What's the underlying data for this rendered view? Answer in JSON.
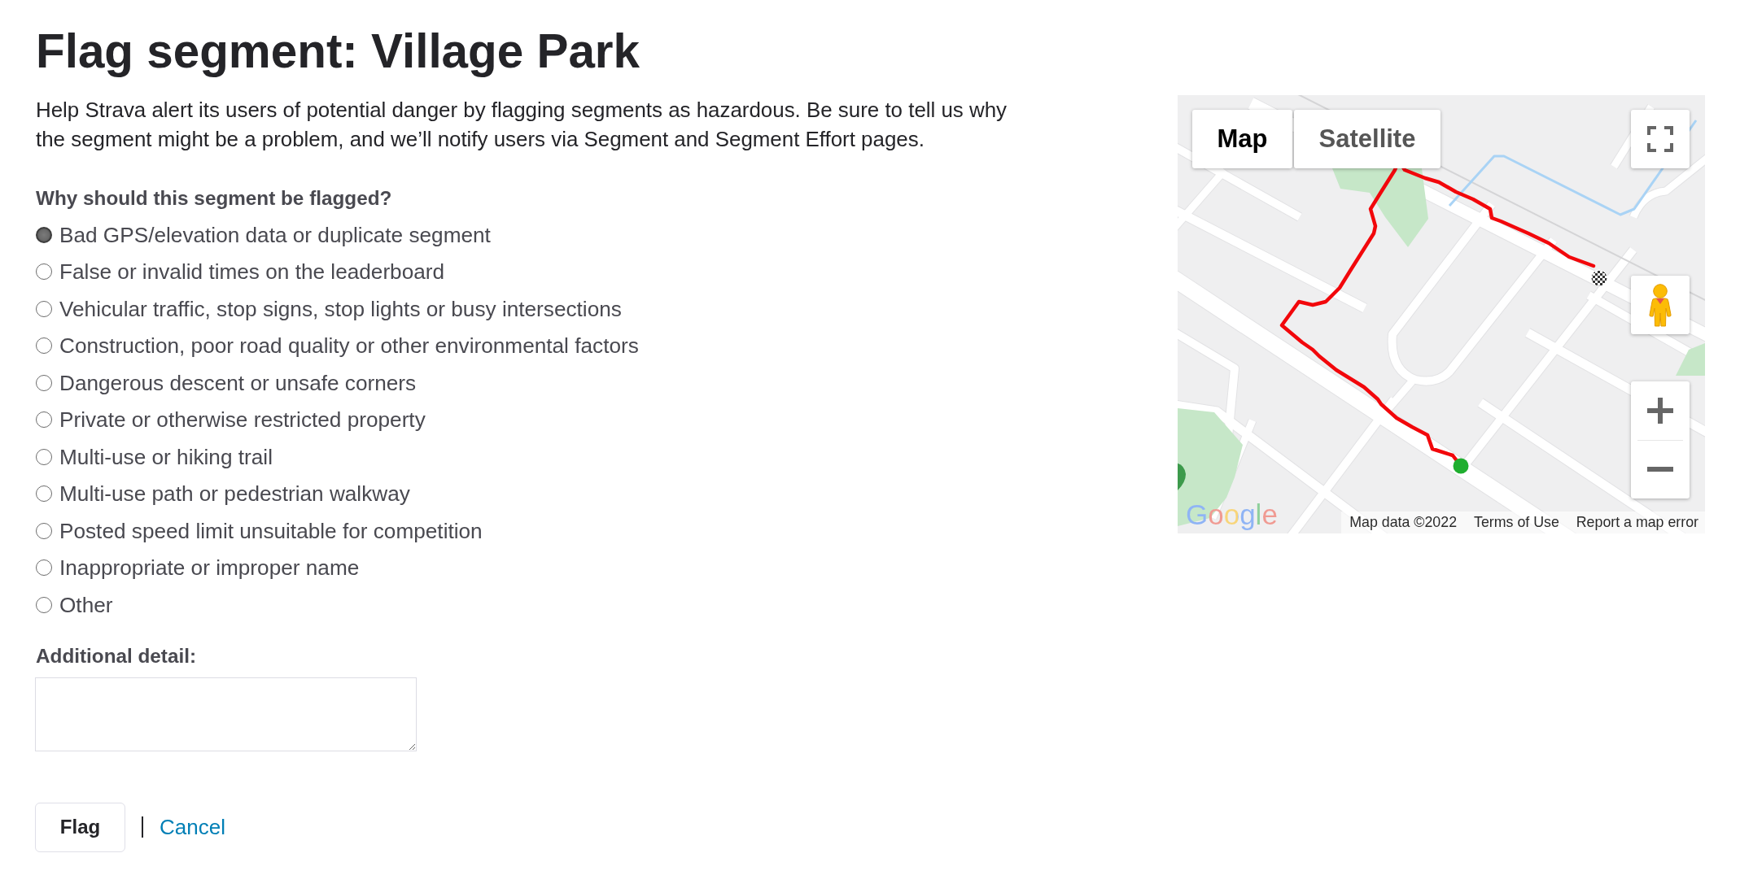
{
  "page": {
    "title": "Flag segment: Village Park",
    "intro": "Help Strava alert its users of potential danger by flagging segments as hazardous. Be sure to tell us why the segment might be a problem, and we’ll notify users via Segment and Segment Effort pages."
  },
  "reasons": {
    "question": "Why should this segment be flagged?",
    "options": [
      {
        "label": "Bad GPS/elevation data or duplicate segment",
        "selected": true
      },
      {
        "label": "False or invalid times on the leaderboard",
        "selected": false
      },
      {
        "label": "Vehicular traffic, stop signs, stop lights or busy intersections",
        "selected": false
      },
      {
        "label": "Construction, poor road quality or other environmental factors",
        "selected": false
      },
      {
        "label": "Dangerous descent or unsafe corners",
        "selected": false
      },
      {
        "label": "Private or otherwise restricted property",
        "selected": false
      },
      {
        "label": "Multi-use or hiking trail",
        "selected": false
      },
      {
        "label": "Multi-use path or pedestrian walkway",
        "selected": false
      },
      {
        "label": "Posted speed limit unsuitable for competition",
        "selected": false
      },
      {
        "label": "Inappropriate or improper name",
        "selected": false
      },
      {
        "label": "Other",
        "selected": false
      }
    ]
  },
  "additional_detail": {
    "label": "Additional detail:"
  },
  "actions": {
    "flag_button": "Flag",
    "cancel_link": "Cancel"
  },
  "map": {
    "map_types": [
      {
        "label": "Map",
        "selected": true
      },
      {
        "label": "Satellite",
        "selected": false
      }
    ],
    "logo": "Google",
    "attribution": [
      "Map data ©2022",
      "Terms of Use",
      "Report a map error"
    ]
  }
}
